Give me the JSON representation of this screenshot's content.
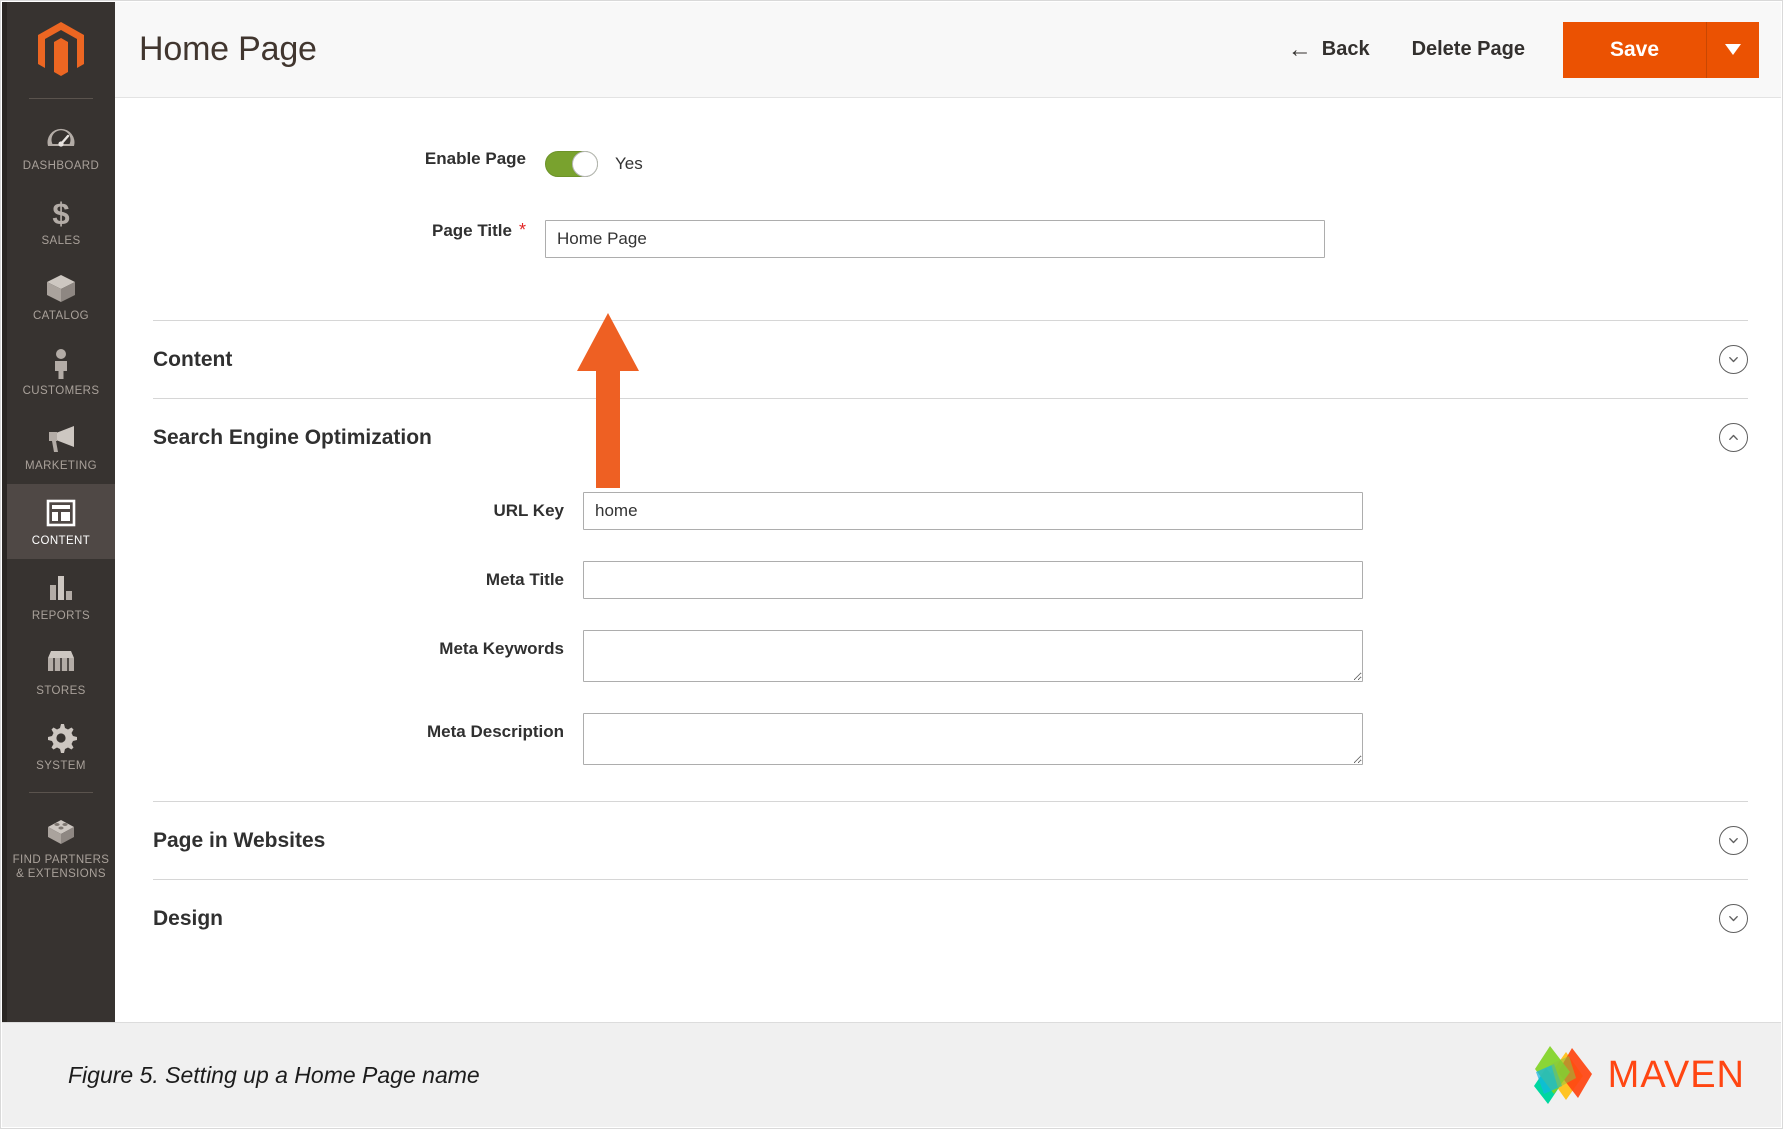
{
  "sidebar": {
    "logo_name": "magento-logo",
    "items": [
      {
        "label": "DASHBOARD",
        "icon": "gauge-icon",
        "active": false
      },
      {
        "label": "SALES",
        "icon": "dollar-icon",
        "active": false
      },
      {
        "label": "CATALOG",
        "icon": "box-icon",
        "active": false
      },
      {
        "label": "CUSTOMERS",
        "icon": "person-icon",
        "active": false
      },
      {
        "label": "MARKETING",
        "icon": "megaphone-icon",
        "active": false
      },
      {
        "label": "CONTENT",
        "icon": "layout-icon",
        "active": true
      },
      {
        "label": "REPORTS",
        "icon": "bar-chart-icon",
        "active": false
      },
      {
        "label": "STORES",
        "icon": "storefront-icon",
        "active": false
      },
      {
        "label": "SYSTEM",
        "icon": "gear-icon",
        "active": false
      },
      {
        "label": "FIND PARTNERS\n& EXTENSIONS",
        "icon": "brick-icon",
        "active": false
      }
    ],
    "partners_line1": "FIND PARTNERS",
    "partners_line2": "& EXTENSIONS"
  },
  "header": {
    "title": "Home Page",
    "back_label": "Back",
    "back_arrow": "←",
    "delete_label": "Delete Page",
    "save_label": "Save",
    "save_dropdown_icon": "caret-down-icon"
  },
  "form": {
    "enable_page": {
      "label": "Enable Page",
      "value": "Yes",
      "state": "on"
    },
    "page_title": {
      "label": "Page Title",
      "required_marker": "*",
      "value": "Home Page",
      "placeholder": ""
    }
  },
  "sections": [
    {
      "id": "content",
      "title": "Content",
      "expanded": false,
      "icon": "chevron-down-icon"
    },
    {
      "id": "seo",
      "title": "Search Engine Optimization",
      "expanded": true,
      "icon": "chevron-up-icon"
    },
    {
      "id": "page-in-websites",
      "title": "Page in Websites",
      "expanded": false,
      "icon": "chevron-down-icon"
    },
    {
      "id": "design",
      "title": "Design",
      "expanded": false,
      "icon": "chevron-down-icon"
    }
  ],
  "seo_fields": [
    {
      "id": "url-key",
      "label": "URL Key",
      "value": "home",
      "type": "input",
      "placeholder": ""
    },
    {
      "id": "meta-title",
      "label": "Meta Title",
      "value": "",
      "type": "input",
      "placeholder": ""
    },
    {
      "id": "meta-keywords",
      "label": "Meta Keywords",
      "value": "",
      "type": "textarea",
      "placeholder": ""
    },
    {
      "id": "meta-description",
      "label": "Meta Description",
      "value": "",
      "type": "textarea",
      "placeholder": ""
    }
  ],
  "annotation": {
    "arrow": "up-arrow-annotation",
    "color": "#ee6023"
  },
  "footer": {
    "caption": "Figure 5. Setting up a Home Page name",
    "brand": "MAVEN",
    "brand_icon": "maven-diamond-logo"
  },
  "colors": {
    "accent_orange": "#eb5202",
    "sidebar_bg": "#373330",
    "sidebar_active": "#4f4845",
    "toggle_green": "#79a22e",
    "required_red": "#e22626",
    "brand_orange": "#ff4612"
  }
}
